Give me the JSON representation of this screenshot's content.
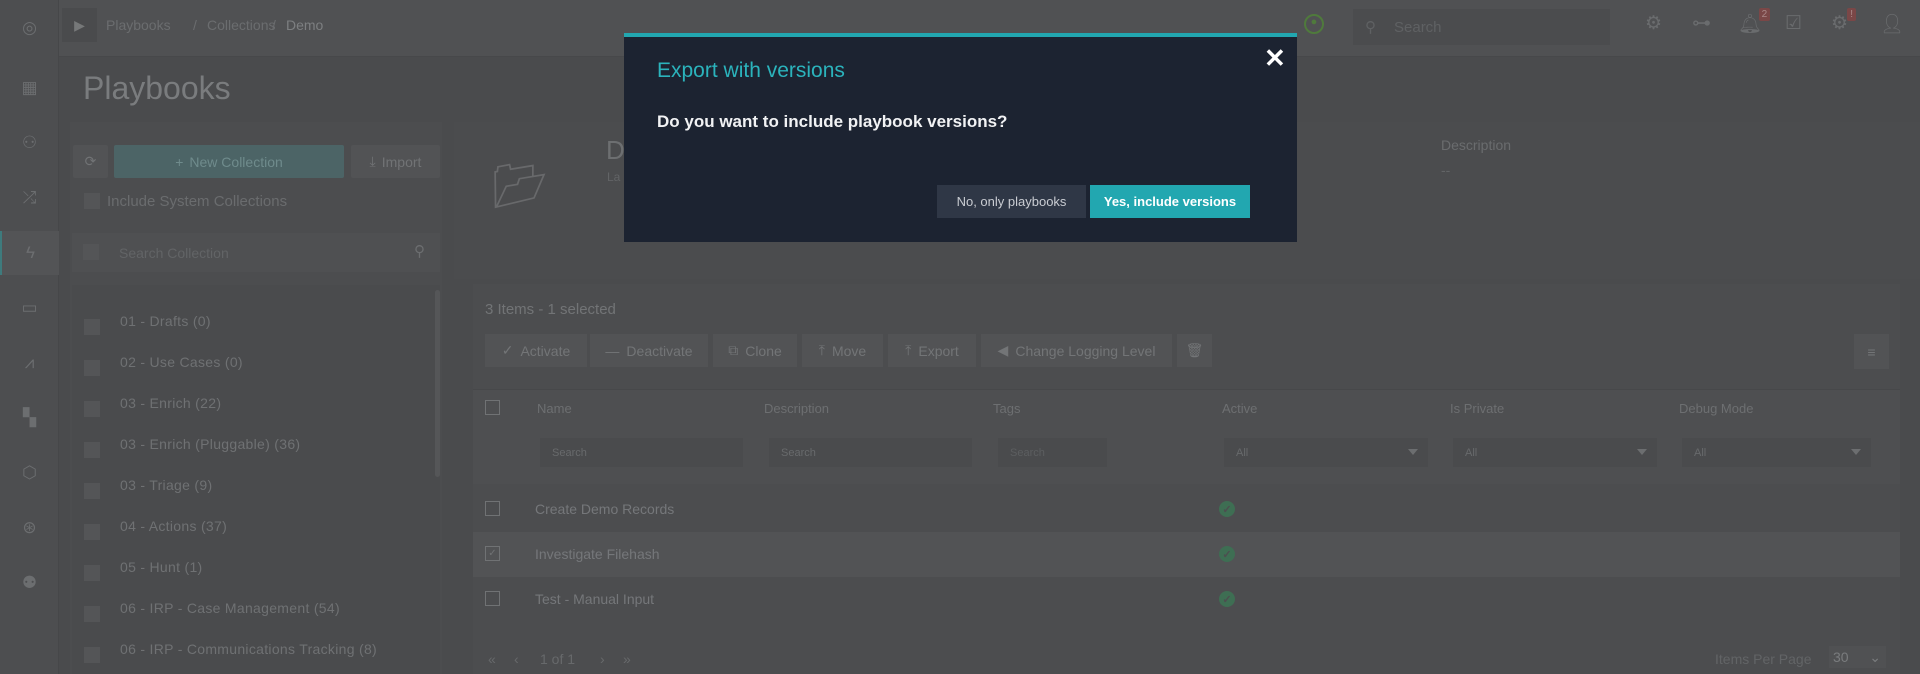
{
  "breadcrumb": [
    "Playbooks",
    "/",
    "Collections",
    "/",
    "Demo"
  ],
  "topbar": {
    "search_placeholder": "Search",
    "notification_count": "2",
    "alert_badge": "!"
  },
  "page_title": "Playbooks",
  "left": {
    "new_collection": "New Collection",
    "import": "Import",
    "include_system": "Include System Collections",
    "search_placeholder": "Search Collection",
    "collections": [
      "01 - Drafts (0)",
      "02 - Use Cases (0)",
      "03 - Enrich (22)",
      "03 - Enrich (Pluggable) (36)",
      "03 - Triage (9)",
      "04 - Actions (37)",
      "05 - Hunt (1)",
      "06 - IRP - Case Management (54)",
      "06 - IRP - Communications Tracking (8)"
    ]
  },
  "detail": {
    "title": "D",
    "subtitle": "La",
    "description_label": "Description",
    "description_value": "--"
  },
  "table": {
    "summary": "3 Items - 1 selected",
    "toolbar": {
      "activate": "Activate",
      "deactivate": "Deactivate",
      "clone": "Clone",
      "move": "Move",
      "export": "Export",
      "logging": "Change Logging Level"
    },
    "columns": [
      "Name",
      "Description",
      "Tags",
      "Active",
      "Is Private",
      "Debug Mode"
    ],
    "filter_placeholder": "Search",
    "select_value": "All",
    "rows": [
      {
        "name": "Create Demo Records",
        "active": true,
        "selected": false
      },
      {
        "name": "Investigate Filehash",
        "active": true,
        "selected": true
      },
      {
        "name": "Test - Manual Input",
        "active": true,
        "selected": false
      }
    ],
    "pagination": {
      "page": "1 of 1",
      "items_per_page_label": "Items Per Page",
      "items_per_page": "30"
    }
  },
  "modal": {
    "title": "Export with versions",
    "question": "Do you want to include playbook versions?",
    "no": "No, only playbooks",
    "yes": "Yes, include versions",
    "accent": "#22a7b0"
  }
}
